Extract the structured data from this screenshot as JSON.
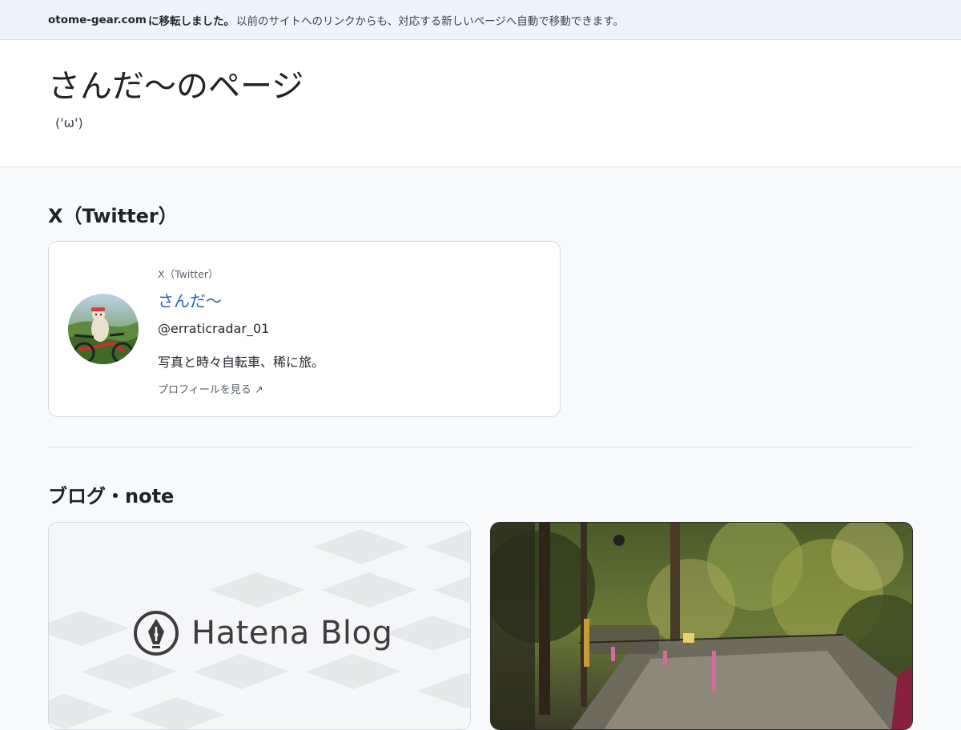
{
  "notice": {
    "domain": "otome-gear.com",
    "moved": " に移転しました。",
    "message": "以前のサイトへのリンクからも、対応する新しいページへ自動で移動できます。"
  },
  "header": {
    "title": "さんだ〜のページ",
    "subtitle": "('ω')"
  },
  "x_section": {
    "title": "X（Twitter）",
    "card": {
      "platform": "X（Twitter）",
      "display_name": "さんだ〜",
      "handle": "@erraticradar_01",
      "bio": "写真と時々自転車、稀に旅。",
      "profile_link": "プロフィールを見る ↗"
    }
  },
  "blog_section": {
    "title": "ブログ・note",
    "cards": [
      {
        "logo_text": "Hatena Blog",
        "logo_icon": "hatena-pen-icon"
      },
      {
        "image": "forest-trail-photo"
      }
    ]
  },
  "colors": {
    "notice_bg": "#eef4fb",
    "link_blue": "#2563b5",
    "border": "#d7dce3"
  }
}
